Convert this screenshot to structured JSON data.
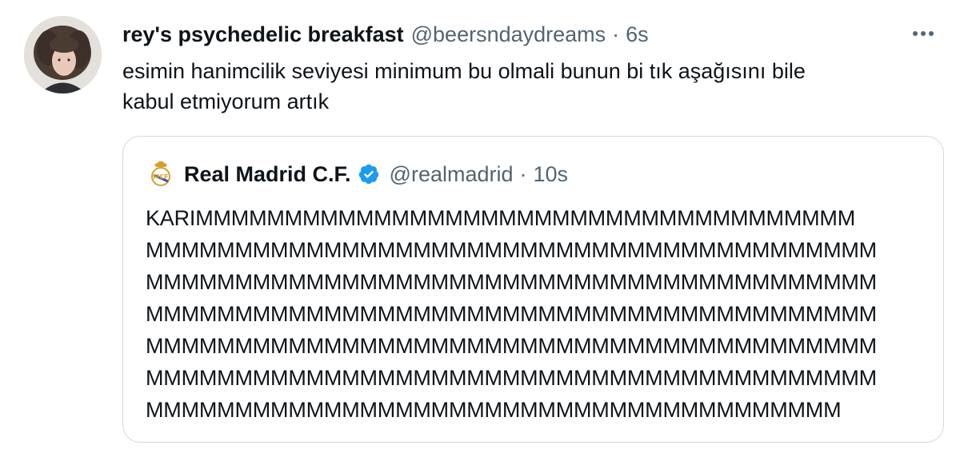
{
  "tweet": {
    "display_name": "rey's psychedelic breakfast",
    "handle": "@beersndaydreams",
    "separator": "·",
    "time": "6s",
    "text_lines": [
      "esimin hanimcilik seviyesi minimum bu olmali bunun bi tık aşağısını bile",
      "kabul etmiyorum artık"
    ],
    "avatar_icon": "user-avatar",
    "more_icon": "more-horizontal-icon"
  },
  "quote": {
    "display_name": "Real Madrid C.F.",
    "verified": true,
    "verified_color": "#1d9bf0",
    "handle": "@realmadrid",
    "separator": "·",
    "time": "10s",
    "logo_icon": "real-madrid-crest",
    "text_lines": [
      "KARIMMMMMMMMMMMMMMMMMMMMMMMMMMMMMMMMMMMMM",
      "MMMMMMMMMMMMMMMMMMMMMMMMMMMMMMMMMMMMMMMMM",
      "MMMMMMMMMMMMMMMMMMMMMMMMMMMMMMMMMMMMMMMMM",
      "MMMMMMMMMMMMMMMMMMMMMMMMMMMMMMMMMMMMMMMMM",
      "MMMMMMMMMMMMMMMMMMMMMMMMMMMMMMMMMMMMMMMMM",
      "MMMMMMMMMMMMMMMMMMMMMMMMMMMMMMMMMMMMMMMMM",
      "MMMMMMMMMMMMMMMMMMMMMMMMMMMMMMMMMMMMMMM"
    ]
  },
  "colors": {
    "text_primary": "#0f1419",
    "text_secondary": "#536471",
    "border": "#cfd9de",
    "verified_blue": "#1d9bf0"
  }
}
